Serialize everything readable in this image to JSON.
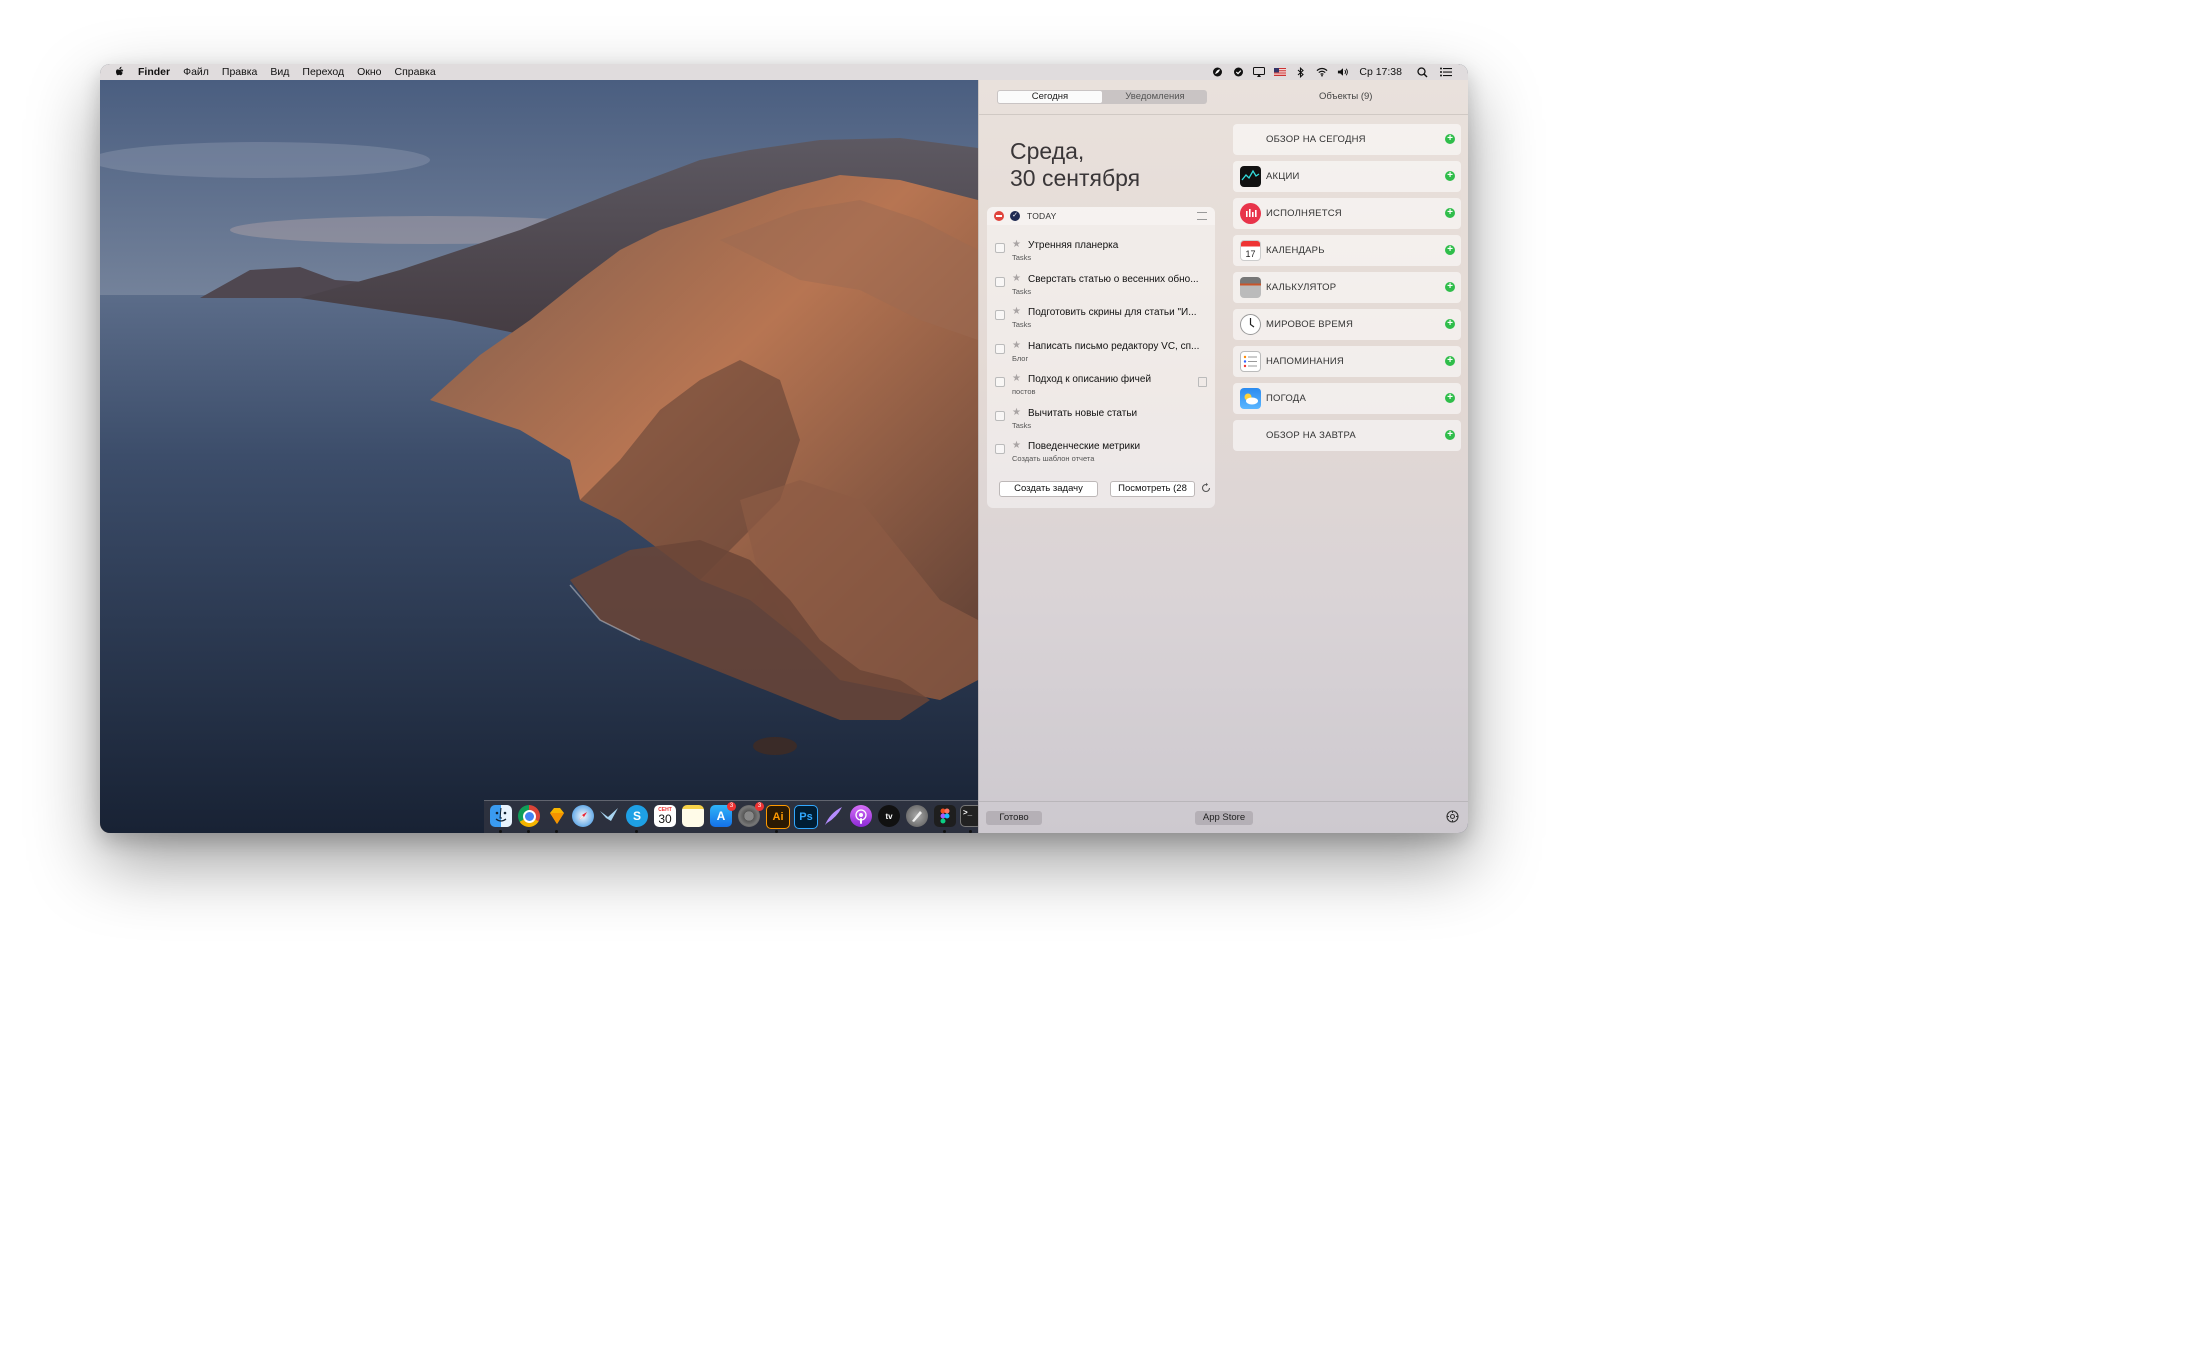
{
  "menubar": {
    "items": [
      "Finder",
      "Файл",
      "Правка",
      "Вид",
      "Переход",
      "Окно",
      "Справка"
    ],
    "clock": "Ср 17:38",
    "status_icons": [
      "leaf-icon",
      "shield-check-icon",
      "airplay-icon",
      "us-flag-icon",
      "bluetooth-icon",
      "wifi-icon",
      "volume-icon",
      "search-icon",
      "notification-list-icon"
    ]
  },
  "notification_center": {
    "tabs": [
      "Сегодня",
      "Уведомления"
    ],
    "active_tab": "Сегодня",
    "objects_label": "Объекты (9)",
    "date_line1": "Среда,",
    "date_line2": "30 сентября",
    "widget": {
      "title": "TODAY",
      "tasks": [
        {
          "title": "Утренняя планерка",
          "project": "Tasks"
        },
        {
          "title": "Сверстать статью о весенних обно...",
          "project": "Tasks"
        },
        {
          "title": "Подготовить скрины для статьи \"И...",
          "project": "Tasks"
        },
        {
          "title": "Написать письмо редактору VC, сп...",
          "project": "Блог"
        },
        {
          "title": "Подход к описанию фичей",
          "project": "постов"
        },
        {
          "title": "Вычитать новые статьи",
          "project": "Tasks"
        },
        {
          "title": "Поведенческие метрики",
          "project": "Создать шаблон отчета"
        }
      ],
      "create_button": "Создать задачу",
      "view_button": "Посмотреть (28"
    },
    "objects": [
      {
        "label": "ОБЗОР НА СЕГОДНЯ",
        "icon": "none"
      },
      {
        "label": "АКЦИИ",
        "icon": "stocks-icon"
      },
      {
        "label": "ИСПОЛНЯЕТСЯ",
        "icon": "now-playing-icon"
      },
      {
        "label": "КАЛЕНДАРЬ",
        "icon": "calendar-icon"
      },
      {
        "label": "КАЛЬКУЛЯТОР",
        "icon": "calculator-icon"
      },
      {
        "label": "МИРОВОЕ ВРЕМЯ",
        "icon": "world-clock-icon"
      },
      {
        "label": "НАПОМИНАНИЯ",
        "icon": "reminders-icon"
      },
      {
        "label": "ПОГОДА",
        "icon": "weather-icon"
      },
      {
        "label": "ОБЗОР НА ЗАВТРА",
        "icon": "none"
      }
    ],
    "done_button": "Готово",
    "app_store_button": "App Store"
  },
  "dock": {
    "apps": [
      "finder-icon",
      "chrome-icon",
      "sketch-icon",
      "safari-icon",
      "migrate-icon",
      "skype-icon",
      "calendar-icon",
      "notes-icon",
      "app-store-icon",
      "system-preferences-icon",
      "illustrator-icon",
      "photoshop-icon",
      "quill-icon",
      "podcasts-icon",
      "apple-tv-icon",
      "launchpad-icon",
      "figma-icon",
      "terminal-icon"
    ],
    "calendar_day": "30",
    "calendar_month": "СЕНТ",
    "app_store_badge": "3",
    "system_preferences_badge": "3",
    "tv_label": "tv"
  },
  "colors": {
    "accent_green": "#2fbd4a",
    "close_red": "#e0443c"
  }
}
